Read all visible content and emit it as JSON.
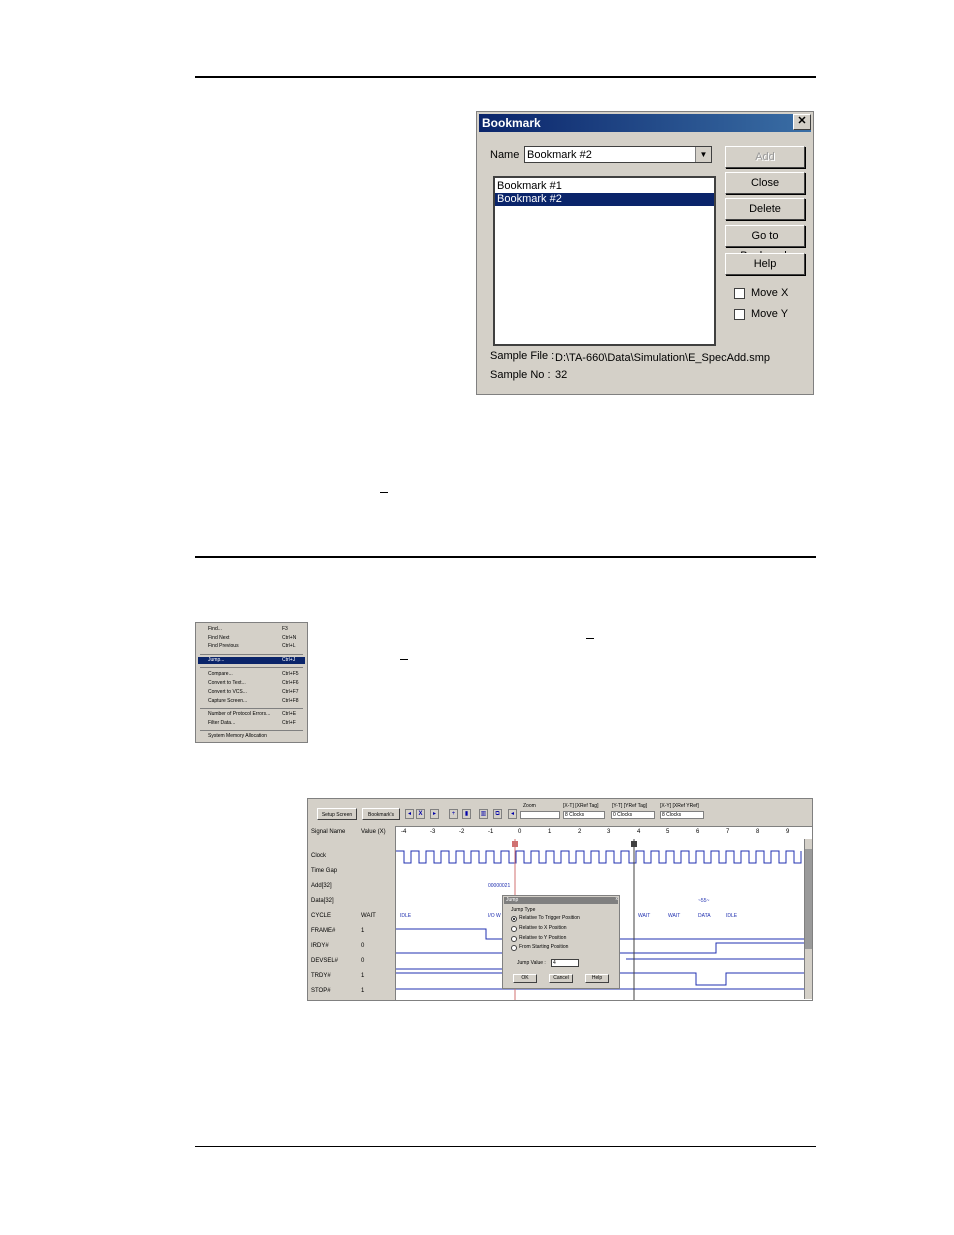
{
  "bookmark_dialog": {
    "title": "Bookmark",
    "close_glyph": "✕",
    "name_label": "Name",
    "name_value": "Bookmark #2",
    "list_items": [
      "Bookmark #1",
      "Bookmark #2"
    ],
    "selected_index": 1,
    "buttons": {
      "add": "Add",
      "close": "Close",
      "delete": "Delete",
      "goto": "Go to Bookmark",
      "help": "Help"
    },
    "move_x": "Move X",
    "move_y": "Move Y",
    "sample_file_label": "Sample File :",
    "sample_file_value": "D:\\TA-660\\Data\\Simulation\\E_SpecAdd.smp",
    "sample_no_label": "Sample No :",
    "sample_no_value": "32"
  },
  "edit_menu": {
    "items": [
      {
        "label": "Find...",
        "shortcut": "F3"
      },
      {
        "label": "Find Next",
        "shortcut": "Ctrl+N"
      },
      {
        "label": "Find Previous",
        "shortcut": "Ctrl+L"
      },
      {
        "label": "Jump...",
        "shortcut": "Ctrl+J",
        "highlighted": true
      },
      {
        "label": "Compare...",
        "shortcut": "Ctrl+F5"
      },
      {
        "label": "Convert to Text...",
        "shortcut": "Ctrl+F6"
      },
      {
        "label": "Convert to VCS...",
        "shortcut": "Ctrl+F7"
      },
      {
        "label": "Capture Screen...",
        "shortcut": "Ctrl+F8"
      },
      {
        "label": "Number of Protocol Errors...",
        "shortcut": "Ctrl+E"
      },
      {
        "label": "Filter Data...",
        "shortcut": "Ctrl+F"
      },
      {
        "label": "System Memory Allocation",
        "shortcut": ""
      }
    ]
  },
  "waveform": {
    "toolbar": {
      "setup_screen": "Setup Screen",
      "bookmarks": "Bookmark's",
      "zoom_label": "Zoom",
      "t_ref_header": "[X-T] [XRef Tag]",
      "t_ref_value": "8 Clocks",
      "yt_ref_header": "[Y-T] [YRef Tag]",
      "yt_ref_value": "0 Clocks",
      "xy_ref_header": "[X-Y] [XRef YRef]",
      "xy_ref_value": "8 Clocks"
    },
    "columns": {
      "signal": "Signal Name",
      "value": "Value (X)"
    },
    "ticks": [
      "-4",
      "-3",
      "-2",
      "-1",
      "0",
      "1",
      "2",
      "3",
      "4",
      "5",
      "6",
      "7",
      "8",
      "9"
    ],
    "signals": [
      {
        "name": "Clock",
        "value": ""
      },
      {
        "name": "Time Gap",
        "value": ""
      },
      {
        "name": "Add[32]",
        "value": ""
      },
      {
        "name": "Data[32]",
        "value": ""
      },
      {
        "name": "CYCLE",
        "value": "WAIT"
      },
      {
        "name": "FRAME#",
        "value": "1"
      },
      {
        "name": "IRDY#",
        "value": "0"
      },
      {
        "name": "DEVSEL#",
        "value": "0"
      },
      {
        "name": "TRDY#",
        "value": "1"
      },
      {
        "name": "STOP#",
        "value": "1"
      }
    ],
    "annotations": {
      "addr": "00000021",
      "data": "~55~",
      "cycle": [
        "IDLE",
        "I/O W",
        "WAIT",
        "WAIT",
        "DATA",
        "IDLE"
      ]
    },
    "jump_dialog": {
      "title": "Jump",
      "close_glyph": "x",
      "group_label": "Jump Type",
      "options": [
        "Relative To Trigger Position",
        "Relative to X Position",
        "Relative to Y Position",
        "From Starting Position"
      ],
      "selected": 0,
      "value_label": "Jump Value :",
      "value": "4",
      "ok": "OK",
      "cancel": "Cancel",
      "help": "Help"
    }
  },
  "colors": {
    "selection": "#0a246a",
    "window_bg": "#d4d0c8",
    "waveform": "#2030b0"
  }
}
